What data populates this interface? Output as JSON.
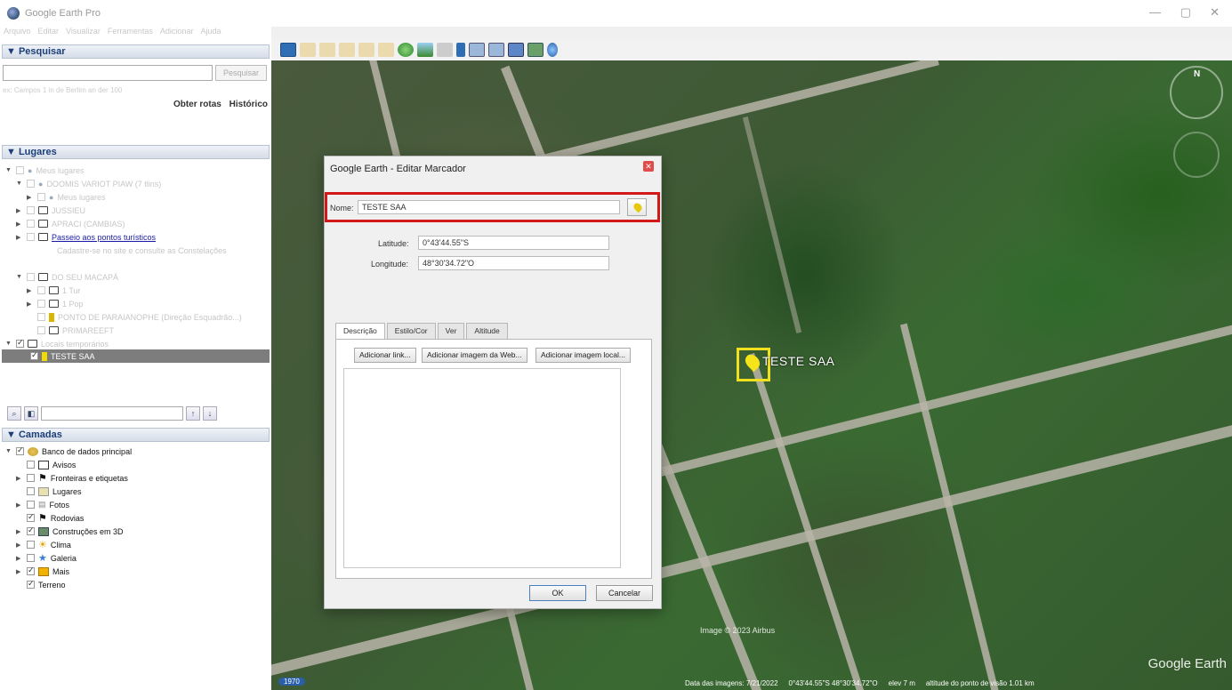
{
  "window": {
    "title": "Google Earth Pro",
    "minimize": "—",
    "maximize": "▢",
    "close": "✕"
  },
  "menu": [
    "Arquivo",
    "Editar",
    "Visualizar",
    "Ferramentas",
    "Adicionar",
    "Ajuda"
  ],
  "search": {
    "header": "▼ Pesquisar",
    "button_label": "Pesquisar",
    "hint": "ex: Campos 1 in de Berlim an der 100",
    "get_directions": "Obter rotas",
    "history": "Histórico"
  },
  "places": {
    "header": "▼ Lugares",
    "items": [
      {
        "label": "Meus lugares",
        "faded": true
      },
      {
        "label": "DOOMIS VARIOT PIAW (7 tlins)",
        "faded": true
      },
      {
        "label": "Meus lugares",
        "faded": true
      },
      {
        "label": "JUSSIEU",
        "faded": true
      },
      {
        "label": "APRACI (CAMBIAS)",
        "faded": true
      },
      {
        "label": "Passeio aos pontos turísticos",
        "faded": false,
        "link": true
      },
      {
        "label": "Cadastre-se no site e consulte as Constelações",
        "faded": true
      },
      {
        "label": "DO SEU MACAPÁ",
        "faded": true
      },
      {
        "label": "1 Tur",
        "faded": true
      },
      {
        "label": "1 Pop",
        "faded": true
      },
      {
        "label": "PONTO DE PARAIANOPHE (Direção Esquadrão...)",
        "faded": true
      },
      {
        "label": "PRIMAREEFT",
        "faded": true
      },
      {
        "label": "Locais temporários",
        "faded": true
      }
    ],
    "selected": "TESTE SAA"
  },
  "layers": {
    "header": "▼ Camadas",
    "items": [
      {
        "label": "Banco de dados principal",
        "checked": true
      },
      {
        "label": "Avisos",
        "checked": false
      },
      {
        "label": "Fronteiras e etiquetas",
        "checked": false
      },
      {
        "label": "Lugares",
        "checked": false
      },
      {
        "label": "Fotos",
        "checked": false
      },
      {
        "label": "Rodovias",
        "checked": true
      },
      {
        "label": "Construções em 3D",
        "checked": true
      },
      {
        "label": "Clima",
        "checked": false
      },
      {
        "label": "Galeria",
        "checked": false
      },
      {
        "label": "Mais",
        "checked": true
      },
      {
        "label": "Terreno",
        "checked": true
      }
    ]
  },
  "dialog": {
    "title": "Google Earth - Editar Marcador",
    "name_label": "Nome:",
    "name_value": "TESTE SAA",
    "latitude_label": "Latitude:",
    "latitude_value": "0°43'44.55\"S",
    "longitude_label": "Longitude:",
    "longitude_value": "48°30'34.72\"O",
    "tabs": [
      "Descrição",
      "Estilo/Cor",
      "Ver",
      "Altitude"
    ],
    "add_link": "Adicionar link...",
    "add_web_image": "Adicionar imagem da Web...",
    "add_local_image": "Adicionar imagem local...",
    "ok": "OK",
    "cancel": "Cancelar"
  },
  "map": {
    "placemark_label": "TESTE SAA",
    "credit": "Image © 2023 Airbus",
    "brand": "Google Earth",
    "compass_n": "N",
    "year": "1970",
    "status": {
      "imagery_date": "Data das imagens: 7/21/2022",
      "coords": "0°43'44.55\"S  48°30'34.72\"O",
      "elev": "elev  7 m",
      "eye_alt": "altitude do ponto de visão  1.01 km"
    }
  }
}
